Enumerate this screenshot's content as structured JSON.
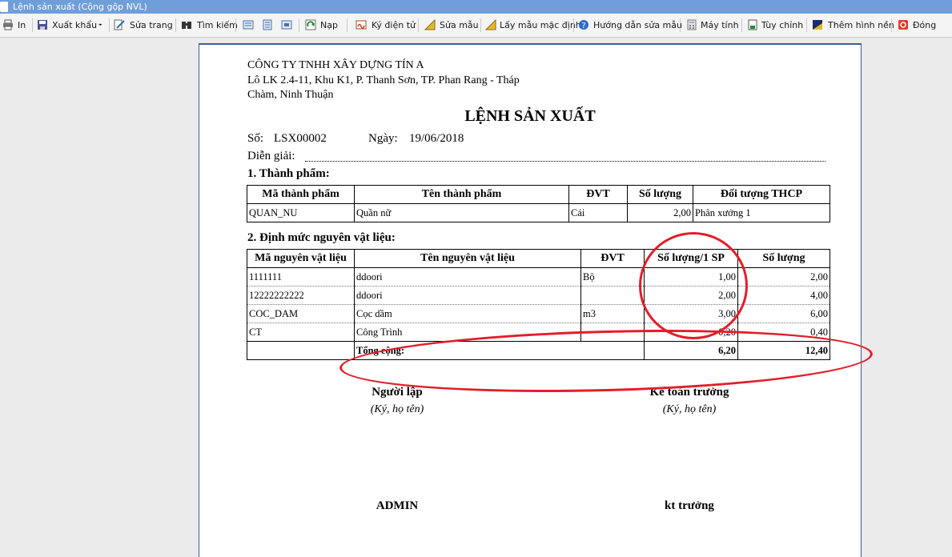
{
  "window": {
    "title": "Lệnh sản xuất (Cộng gộp NVL)"
  },
  "toolbar": {
    "print_label": "In",
    "export_label": "Xuất khẩu",
    "edit_page_label": "Sửa trang",
    "search_label": "Tìm kiếm",
    "load_label": "Nạp",
    "e_sign_label": "Ký điện tử",
    "edit_template_label": "Sửa mẫu",
    "default_template_label": "Lấy mẫu mặc định",
    "template_help_label": "Hướng dẫn sửa mẫu",
    "calculator_label": "Máy tính",
    "customize_label": "Tùy chỉnh",
    "add_background_label": "Thêm hình nền",
    "close_label": "Đóng"
  },
  "document": {
    "company_name": "CÔNG TY TNHH XÂY DỰNG TÍN A",
    "address_line1": "Lô LK 2.4-11, Khu K1, P. Thanh Sơn, TP. Phan Rang - Tháp",
    "address_line2": "Chàm, Ninh Thuận",
    "title": "LỆNH SẢN XUẤT",
    "number_label": "Số:",
    "number_value": "LSX00002",
    "date_label": "Ngày:",
    "date_value": "19/06/2018",
    "description_label": "Diễn giải:",
    "section1_title": "1. Thành phẩm:",
    "products": {
      "headers": [
        "Mã thành phẩm",
        "Tên thành phẩm",
        "ĐVT",
        "Số lượng",
        "Đối tượng THCP"
      ],
      "rows": [
        [
          "QUAN_NU",
          "Quần nữ",
          "Cái",
          "2,00",
          "Phân xưởng 1"
        ]
      ]
    },
    "section2_title": "2. Định mức nguyên vật liệu:",
    "materials": {
      "headers": [
        "Mã nguyên vật liệu",
        "Tên nguyên vật liệu",
        "ĐVT",
        "Số lượng/1 SP",
        "Số lượng"
      ],
      "rows": [
        [
          "1111111",
          "ddoori",
          "Bộ",
          "1,00",
          "2,00"
        ],
        [
          "12222222222",
          "ddoori",
          "",
          "2,00",
          "4,00"
        ],
        [
          "COC_DAM",
          "Cọc dầm",
          "m3",
          "3,00",
          "6,00"
        ],
        [
          "CT",
          "Công Trình",
          "",
          "0,20",
          "0,40"
        ]
      ],
      "total_label": "Tổng cộng:",
      "total_per_unit": "6,20",
      "total_quantity": "12,40"
    },
    "signatures": {
      "preparer_title": "Người lập",
      "preparer_note": "(Ký, họ tên)",
      "preparer_name": "ADMIN",
      "accountant_title": "Kế toán trưởng",
      "accountant_note": "(Ký, họ tên)",
      "accountant_name": "kt trưởng"
    }
  }
}
